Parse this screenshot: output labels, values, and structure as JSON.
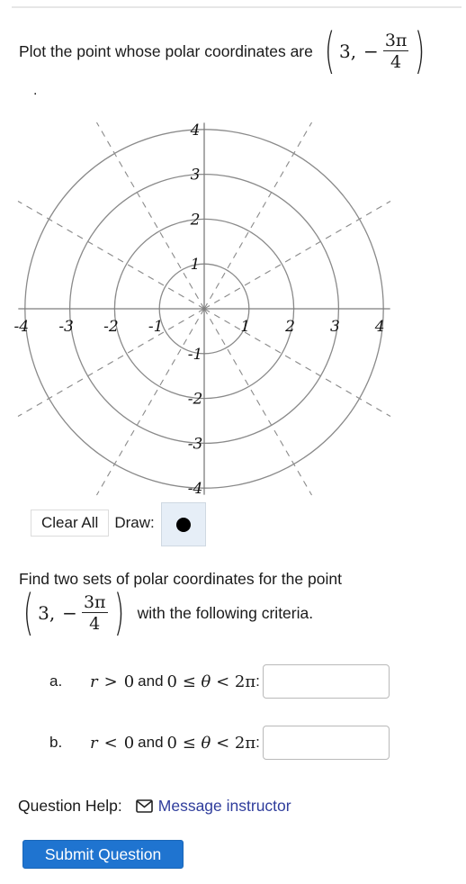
{
  "prompt": {
    "text": "Plot the point whose polar coordinates are",
    "point": {
      "r": "3",
      "theta_sign": "−",
      "theta_num": "3π",
      "theta_den": "4"
    },
    "trailing": "."
  },
  "graph": {
    "rings": [
      1,
      2,
      3,
      4
    ],
    "ray_angles_deg": [
      30,
      60,
      120,
      150,
      210,
      240,
      300,
      330
    ],
    "x_ticks": [
      {
        "v": -4,
        "label": "-4"
      },
      {
        "v": -3,
        "label": "-3"
      },
      {
        "v": -2,
        "label": "-2"
      },
      {
        "v": -1,
        "label": "-1"
      },
      {
        "v": 1,
        "label": "1"
      },
      {
        "v": 2,
        "label": "2"
      },
      {
        "v": 3,
        "label": "3"
      },
      {
        "v": 4,
        "label": "4"
      }
    ],
    "y_ticks": [
      {
        "v": 4,
        "label": "4"
      },
      {
        "v": 3,
        "label": "3"
      },
      {
        "v": 2,
        "label": "2"
      },
      {
        "v": 1,
        "label": "1"
      },
      {
        "v": -1,
        "label": "-1"
      },
      {
        "v": -2,
        "label": "-2"
      },
      {
        "v": -3,
        "label": "-3"
      },
      {
        "v": -4,
        "label": "-4"
      }
    ],
    "axis_range": [
      -4.15,
      4.15
    ]
  },
  "controls": {
    "clear_label": "Clear All",
    "draw_label": "Draw:",
    "draw_tool": "point-tool"
  },
  "question2": {
    "line1": "Find two sets of polar coordinates for the point",
    "after_point": "with the following criteria."
  },
  "criteria": [
    {
      "label": "a.",
      "r_var": "r",
      "rel": ">",
      "zero": "0",
      "and": "and",
      "range": "0 ≤ ",
      "theta": "θ",
      "upper": " < 2π",
      "colon": ":",
      "value": ""
    },
    {
      "label": "b.",
      "r_var": "r",
      "rel": "<",
      "zero": "0",
      "and": "and",
      "range": "0 ≤ ",
      "theta": "θ",
      "upper": " < 2π",
      "colon": ":",
      "value": ""
    }
  ],
  "help": {
    "label": "Question Help:",
    "link": "Message instructor",
    "icon": "mail-icon"
  },
  "submit_label": "Submit Question",
  "colors": {
    "accent": "#1f74d0",
    "link": "#2f3d9c",
    "grid": "#8a8a8a",
    "draw_tool_bg": "#e6eef7"
  }
}
